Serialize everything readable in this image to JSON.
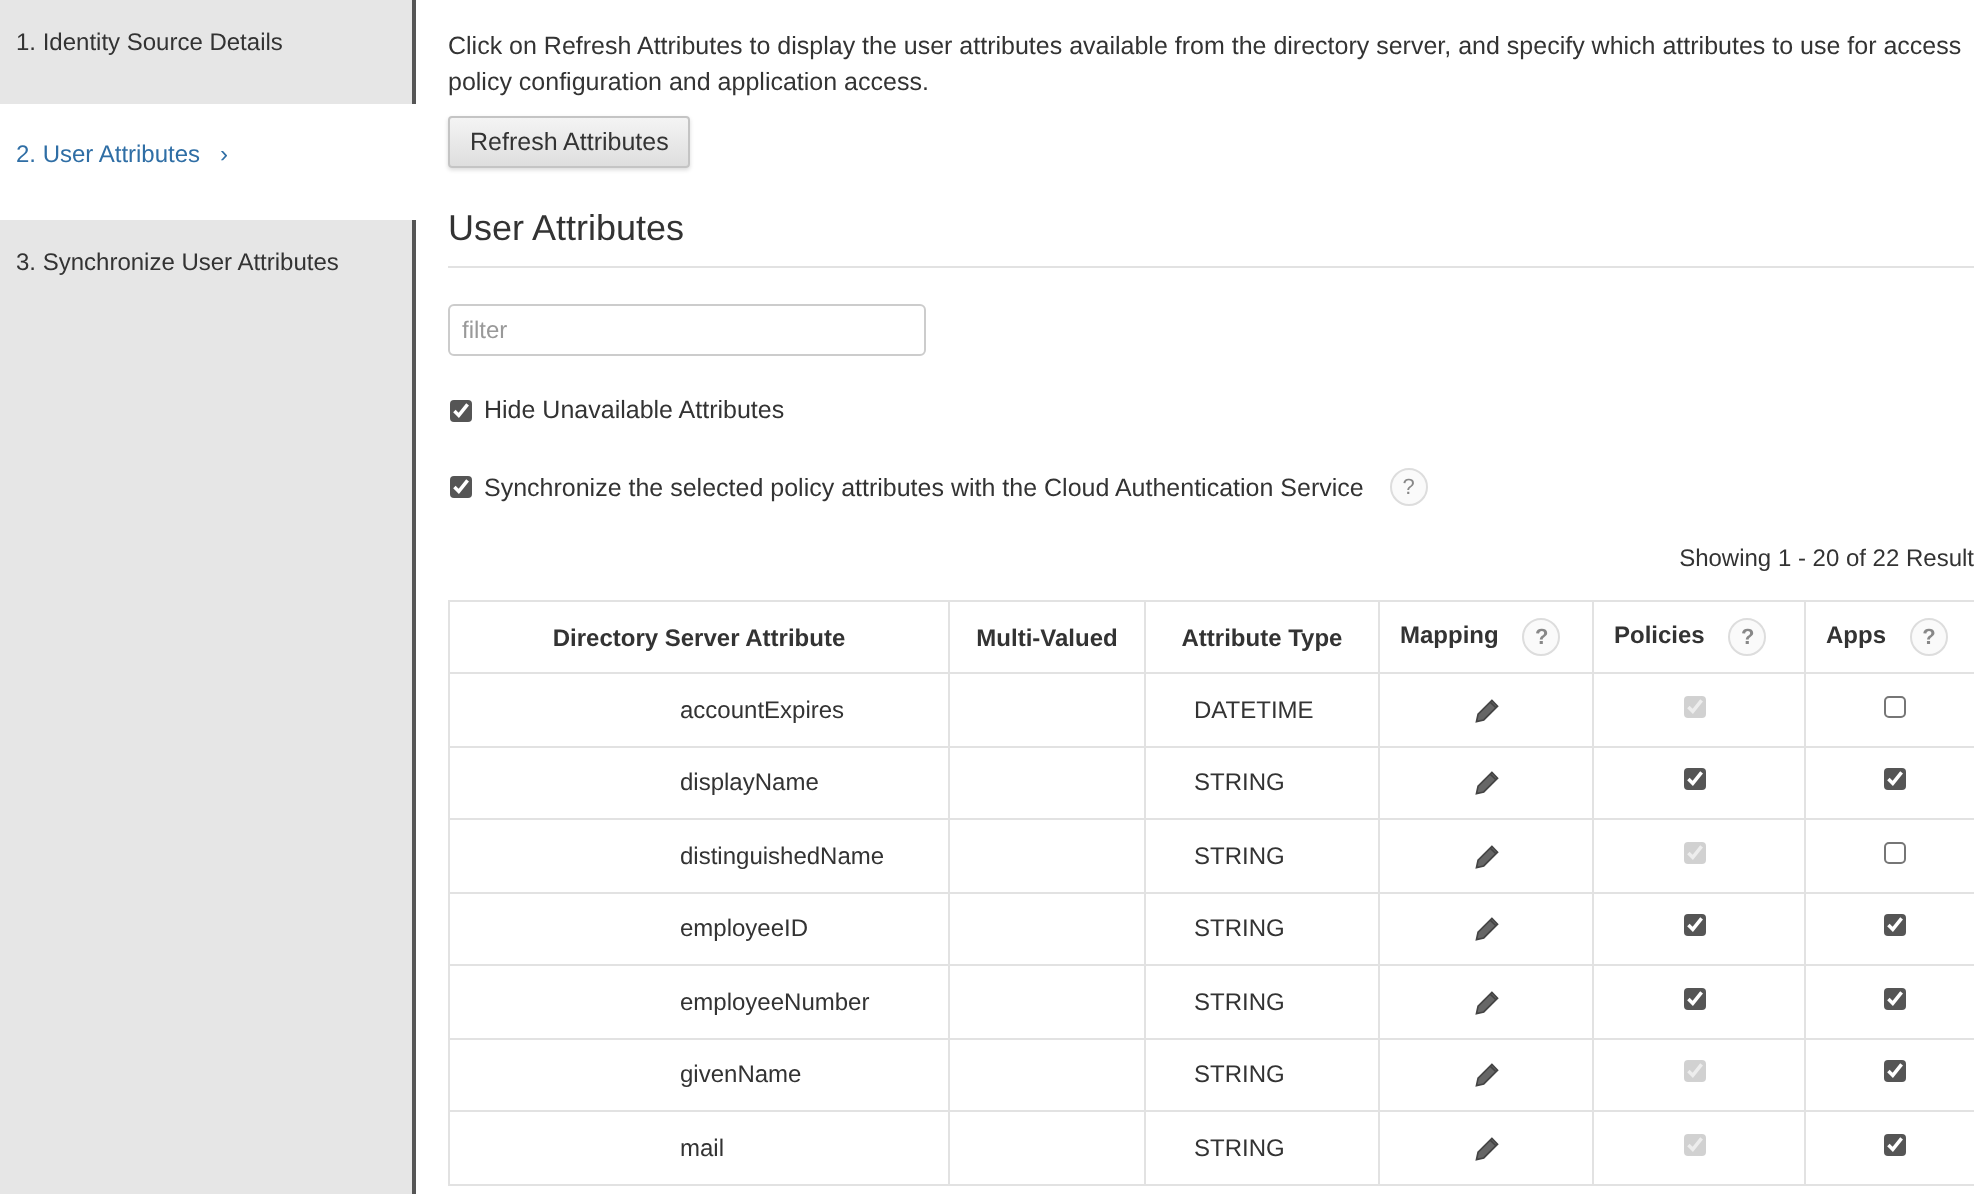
{
  "steps": [
    {
      "label": "1. Identity Source Details",
      "selected": false
    },
    {
      "label": "2. User Attributes",
      "selected": true,
      "chevron": "›"
    },
    {
      "label": "3. Synchronize User Attributes",
      "selected": false
    }
  ],
  "intro": "Click on Refresh Attributes to display the user attributes available from the directory server, and specify which attributes to use for access policy configuration and application access.",
  "refresh_button": "Refresh Attributes",
  "section_title": "User Attributes",
  "filter": {
    "placeholder": "filter"
  },
  "options": [
    {
      "label": "Hide Unavailable Attributes",
      "checked": true
    },
    {
      "label": "Synchronize the selected policy attributes with the Cloud Authentication Service",
      "checked": true,
      "help_text": "?"
    }
  ],
  "result_count": "Showing 1 - 20 of 22 Result",
  "table": {
    "columns": [
      {
        "label": "Directory Server Attribute"
      },
      {
        "label": "Multi-Valued"
      },
      {
        "label": "Attribute Type"
      },
      {
        "label": "Mapping",
        "help": "?"
      },
      {
        "label": "Policies",
        "help": "?"
      },
      {
        "label": "Apps",
        "help": "?"
      }
    ],
    "rows": [
      {
        "attribute": "accountExpires",
        "type": "DATETIME",
        "policies": {
          "checked": true,
          "disabled": true
        },
        "apps": {
          "checked": false,
          "disabled": false
        }
      },
      {
        "attribute": "displayName",
        "type": "STRING",
        "policies": {
          "checked": true,
          "disabled": false
        },
        "apps": {
          "checked": true,
          "disabled": false
        }
      },
      {
        "attribute": "distinguishedName",
        "type": "STRING",
        "policies": {
          "checked": true,
          "disabled": true
        },
        "apps": {
          "checked": false,
          "disabled": false
        }
      },
      {
        "attribute": "employeeID",
        "type": "STRING",
        "policies": {
          "checked": true,
          "disabled": false
        },
        "apps": {
          "checked": true,
          "disabled": false
        }
      },
      {
        "attribute": "employeeNumber",
        "type": "STRING",
        "policies": {
          "checked": true,
          "disabled": false
        },
        "apps": {
          "checked": true,
          "disabled": false
        }
      },
      {
        "attribute": "givenName",
        "type": "STRING",
        "policies": {
          "checked": true,
          "disabled": true
        },
        "apps": {
          "checked": true,
          "disabled": false
        }
      },
      {
        "attribute": "mail",
        "type": "STRING",
        "policies": {
          "checked": true,
          "disabled": true
        },
        "apps": {
          "checked": true,
          "disabled": false
        }
      }
    ]
  }
}
